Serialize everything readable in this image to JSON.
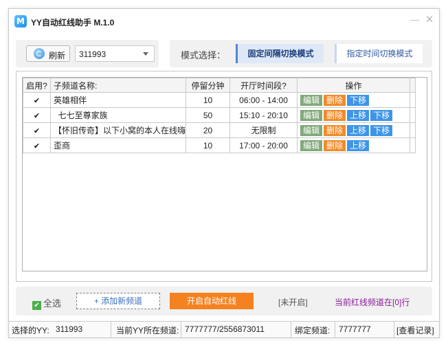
{
  "app": {
    "title": "YY自动红线助手  M.1.0",
    "icon_letter": "M"
  },
  "toolbar": {
    "refresh_label": "刷新",
    "yy_value": "311993"
  },
  "mode": {
    "label": "模式选择：",
    "fixed_label": "固定间隔切换模式",
    "time_label": "指定时间切换模式"
  },
  "table": {
    "headers": [
      "启用?",
      "子频道名称:",
      "停留分钟",
      "开厅时间段?",
      "操作"
    ],
    "rows": [
      {
        "enabled": "✔",
        "name": "英雄相伴",
        "minutes": "10",
        "period": "06:00 - 14:00",
        "actions": [
          "编辑",
          "删除",
          "下移"
        ]
      },
      {
        "enabled": "✔",
        "name": "  七七至尊家族",
        "minutes": "50",
        "period": "15:10 - 20:10",
        "actions": [
          "编辑",
          "删除",
          "上移",
          "下移"
        ]
      },
      {
        "enabled": "✔",
        "name": "【怀旧传奇】以下小窝的本人在线嗨",
        "minutes": "20",
        "period": "无限制",
        "actions": [
          "编辑",
          "删除",
          "上移",
          "下移"
        ]
      },
      {
        "enabled": "✔",
        "name": "歪商",
        "minutes": "10",
        "period": "17:00 - 20:00",
        "actions": [
          "编辑",
          "删除",
          "上移"
        ]
      }
    ]
  },
  "bottom": {
    "select_all": "全选",
    "add_channel": "+ 添加新频道",
    "start": "开启自动红线",
    "status": "[未开启]",
    "current": "当前红线频道在[0]行"
  },
  "statusbar": {
    "yy_label": "选择的YY:",
    "yy_value": "311993",
    "channel_label": "当前YY所在频道:",
    "channel_value": "7777777/2556873011",
    "bind_label": "绑定频道:",
    "bind_value": "7777777",
    "log_link": "[查看记录]"
  },
  "colors": {
    "accent": "#4e86d8",
    "start": "#f58220",
    "edit": "#81a97a",
    "delete": "#f08a2a",
    "move": "#3e95e8",
    "current_text": "#8a1a9a"
  }
}
